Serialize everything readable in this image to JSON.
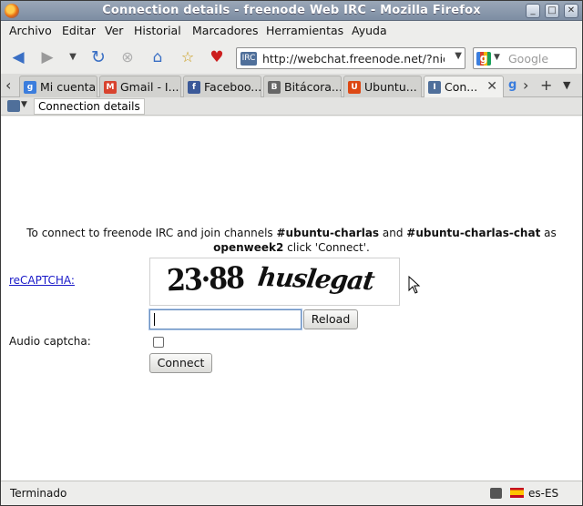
{
  "window": {
    "title": "Connection details - freenode Web IRC - Mozilla Firefox",
    "minimize": "_",
    "maximize": "□",
    "close": "✕"
  },
  "menu": [
    "Archivo",
    "Editar",
    "Ver",
    "Historial",
    "Marcadores",
    "Herramientas",
    "Ayuda"
  ],
  "toolbar": {
    "url": "http://webchat.freenode.net/?nick=",
    "search_placeholder": "Google",
    "icons": [
      "back-arrow-icon",
      "forward-arrow-icon",
      "dropdown-icon",
      "reload-icon",
      "stop-icon",
      "home-icon",
      "bookmark-star-icon",
      "heart-icon"
    ]
  },
  "tabs": [
    {
      "label": "Mi cuenta",
      "icon": "google-icon",
      "color": "#3b7ddd",
      "active": false
    },
    {
      "label": "Gmail - I...",
      "icon": "gmail-icon",
      "color": "#d8432e",
      "active": false
    },
    {
      "label": "Faceboo...",
      "icon": "facebook-icon",
      "color": "#3b5998",
      "active": false
    },
    {
      "label": "Bitácora...",
      "icon": "blog-icon",
      "color": "#666666",
      "active": false
    },
    {
      "label": "Ubuntu...",
      "icon": "ubuntu-icon",
      "color": "#dd4814",
      "active": false
    },
    {
      "label": "Con...",
      "icon": "webchat-icon",
      "color": "#4f6f9a",
      "active": true
    }
  ],
  "strip": {
    "label": "Connection details"
  },
  "page": {
    "intro_prefix": "To connect to freenode IRC and join channels ",
    "channel1": "#ubuntu-charlas",
    "intro_and": " and ",
    "channel2": "#ubuntu-charlas-chat",
    "intro_as": " as",
    "nick": "openweek2",
    "intro_suffix": " click 'Connect'.",
    "recaptcha_label": "reCAPTCHA:",
    "captcha_word1": "23·88",
    "captcha_word2": "huslegat",
    "captcha_value": "",
    "reload_label": "Reload",
    "audio_label": "Audio captcha:",
    "audio_checked": false,
    "connect_label": "Connect"
  },
  "status": {
    "text": "Terminado",
    "language": "es-ES"
  }
}
